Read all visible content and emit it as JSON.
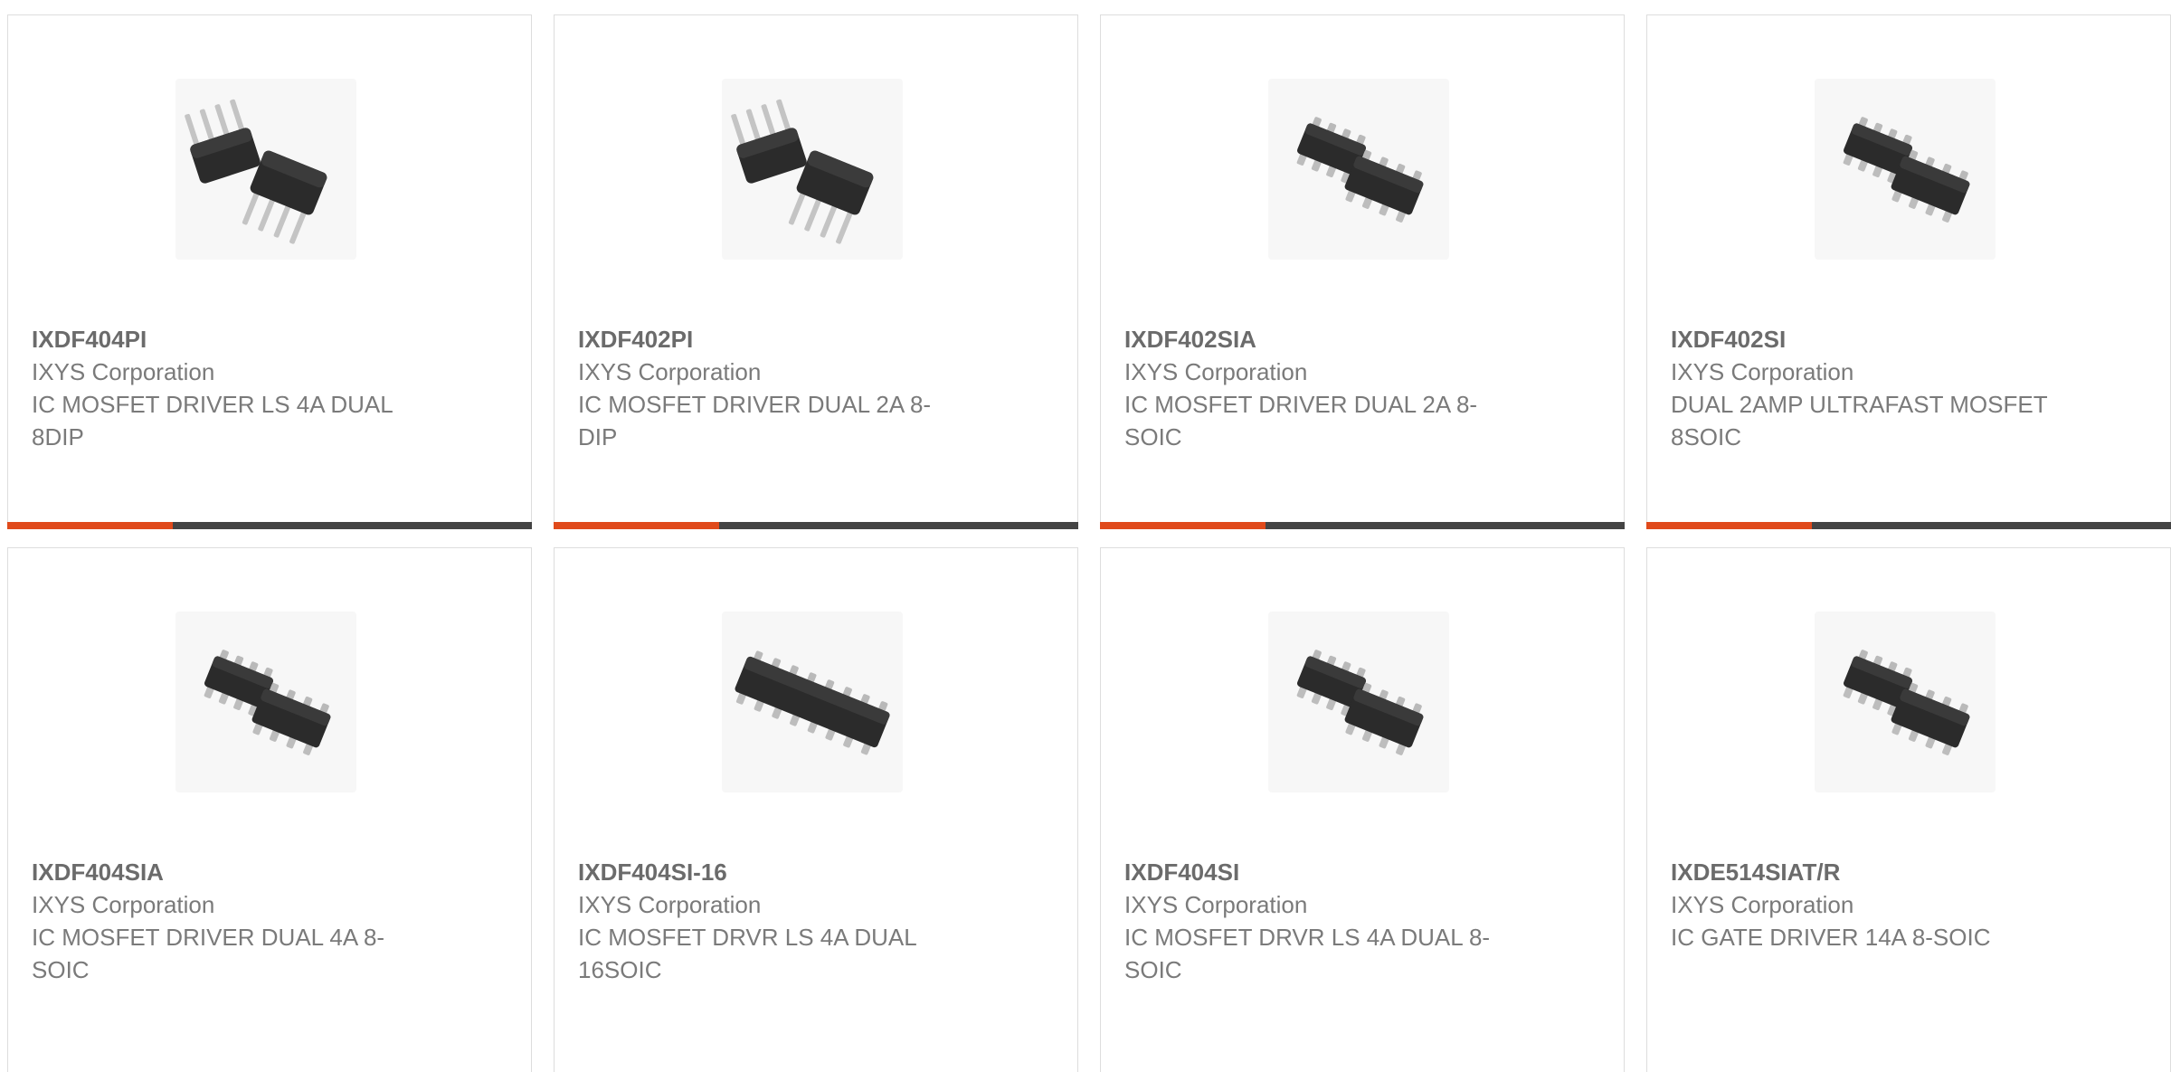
{
  "colors": {
    "accent": "#e04a1b",
    "bar": "#444444",
    "text": "#7a7a7a",
    "border": "#dddddd"
  },
  "products": [
    {
      "part_number": "IXDF404PI",
      "manufacturer": "IXYS Corporation",
      "description": "IC MOSFET DRIVER LS 4A DUAL 8DIP",
      "image_icon": "dip-8-chip-icon"
    },
    {
      "part_number": "IXDF402PI",
      "manufacturer": "IXYS Corporation",
      "description": "IC MOSFET DRIVER DUAL 2A 8-DIP",
      "image_icon": "dip-8-chip-icon"
    },
    {
      "part_number": "IXDF402SIA",
      "manufacturer": "IXYS Corporation",
      "description": "IC MOSFET DRIVER DUAL 2A 8-SOIC",
      "image_icon": "soic-8-chip-icon"
    },
    {
      "part_number": "IXDF402SI",
      "manufacturer": "IXYS Corporation",
      "description": "DUAL 2AMP ULTRAFAST MOSFET 8SOIC",
      "image_icon": "soic-8-chip-icon"
    },
    {
      "part_number": "IXDF404SIA",
      "manufacturer": "IXYS Corporation",
      "description": "IC MOSFET DRIVER DUAL 4A 8-SOIC",
      "image_icon": "soic-8-chip-icon"
    },
    {
      "part_number": "IXDF404SI-16",
      "manufacturer": "IXYS Corporation",
      "description": "IC MOSFET DRVR LS 4A DUAL 16SOIC",
      "image_icon": "soic-16-chip-icon"
    },
    {
      "part_number": "IXDF404SI",
      "manufacturer": "IXYS Corporation",
      "description": "IC MOSFET DRVR LS 4A DUAL 8-SOIC",
      "image_icon": "soic-8-chip-icon"
    },
    {
      "part_number": "IXDE514SIAT/R",
      "manufacturer": "IXYS Corporation",
      "description": "IC GATE DRIVER 14A 8-SOIC",
      "image_icon": "soic-8-chip-icon"
    }
  ]
}
